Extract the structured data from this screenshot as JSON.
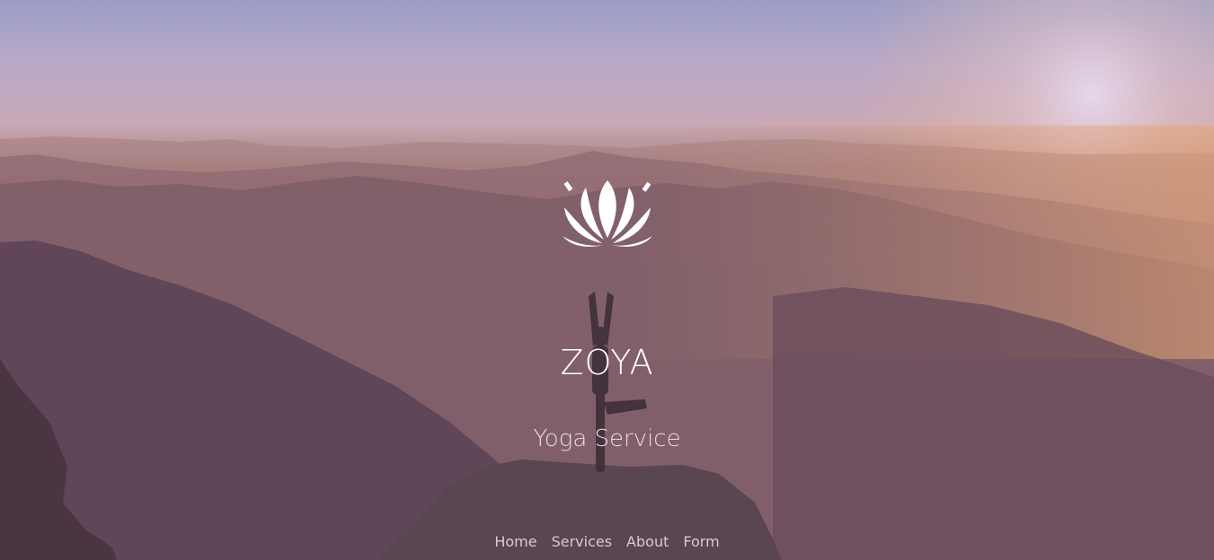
{
  "brand": {
    "name": "ZOYA",
    "tagline": "Yoga Service",
    "logo_icon": "lotus-icon"
  },
  "nav": {
    "items": [
      {
        "label": "Home"
      },
      {
        "label": "Services"
      },
      {
        "label": "About"
      },
      {
        "label": "Form"
      }
    ]
  },
  "colors": {
    "overlay": "#6a4d5f",
    "text": "#ffffff",
    "subtext": "#e6d9e4",
    "nav_text": "#d9c9d8"
  }
}
